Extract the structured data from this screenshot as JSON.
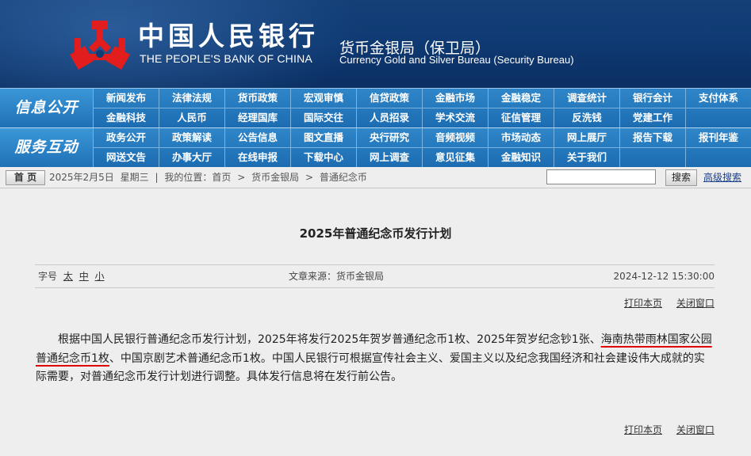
{
  "header": {
    "bank_cn": "中国人民银行",
    "bank_en": "THE PEOPLE'S BANK OF CHINA",
    "bureau_cn": "货币金银局（保卫局）",
    "bureau_en": "Currency  Gold and Silver Bureau (Security Bureau)",
    "logo_icon": "pboc-logo-icon",
    "logo_color": "#e21d1d"
  },
  "nav": {
    "info_title": "信息公开",
    "info_rows": [
      [
        "新闻发布",
        "法律法规",
        "货币政策",
        "宏观审慎",
        "信贷政策",
        "金融市场",
        "金融稳定",
        "调查统计",
        "银行会计",
        "支付体系"
      ],
      [
        "金融科技",
        "人民币",
        "经理国库",
        "国际交往",
        "人员招录",
        "学术交流",
        "征信管理",
        "反洗钱",
        "党建工作",
        ""
      ]
    ],
    "service_title": "服务互动",
    "service_rows": [
      [
        "政务公开",
        "政策解读",
        "公告信息",
        "图文直播",
        "央行研究",
        "音频视频",
        "市场动态",
        "网上展厅",
        "报告下载",
        "报刊年鉴"
      ],
      [
        "网送文告",
        "办事大厅",
        "在线申报",
        "下载中心",
        "网上调查",
        "意见征集",
        "金融知识",
        "关于我们",
        "",
        ""
      ]
    ]
  },
  "breadcrumb": {
    "home_label": "首 页",
    "date": "2025年2月5日",
    "weekday": "星期三",
    "sep": "|",
    "location_label": "我的位置：首页",
    "arrow": ">",
    "level1": "货币金银局",
    "level2": "普通纪念币",
    "search_button": "搜索",
    "advanced_search": "高级搜索"
  },
  "article": {
    "title": "2025年普通纪念币发行计划",
    "font_size_label": "字号",
    "font_sizes": [
      "太",
      "中",
      "小"
    ],
    "source": "文章来源：货币金银局",
    "datetime": "2024-12-12  15:30:00",
    "print_link": "打印本页",
    "close_link": "关闭窗口",
    "body_part1": "根据中国人民银行普通纪念币发行计划，2025年将发行2025年贺岁普通纪念币1枚、2025年贺岁纪念钞1张、",
    "body_highlight": "海南热带雨林国家公园普通纪念币1枚",
    "body_part2": "、中国京剧艺术普通纪念币1枚。中国人民银行可根据宣传社会主义、爱国主义以及纪念我国经济和社会建设伟大成就的实际需要，对普通纪念币发行计划进行调整。具体发行信息将在发行前公告。",
    "highlight_color": "#e00000"
  }
}
